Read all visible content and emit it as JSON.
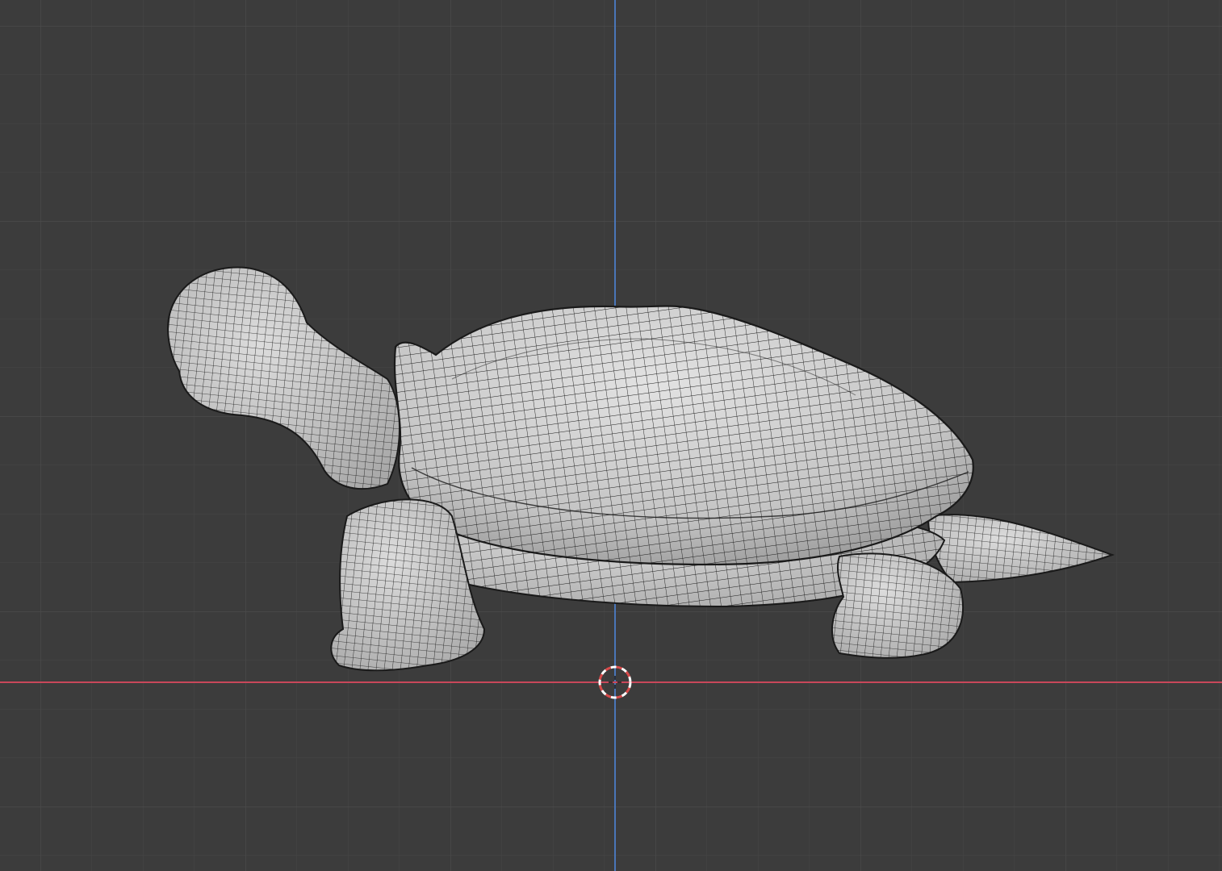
{
  "viewport": {
    "background_color": "#3c3c3c",
    "grid_minor_color": "#464646",
    "grid_major_color": "#4f4f4f",
    "x_axis_color": "#c9475a",
    "y_axis_color": "#4a76b8",
    "grid_visible": true
  },
  "object": {
    "name": "turtle-mesh",
    "shading": "solid",
    "wireframe_overlay": true,
    "surface_color": "#c9c9c9",
    "wire_color": "#1a1a1a"
  },
  "cursor": {
    "icon": "3d-cursor-icon",
    "colors": [
      "#d84a4a",
      "#ffffff"
    ]
  }
}
